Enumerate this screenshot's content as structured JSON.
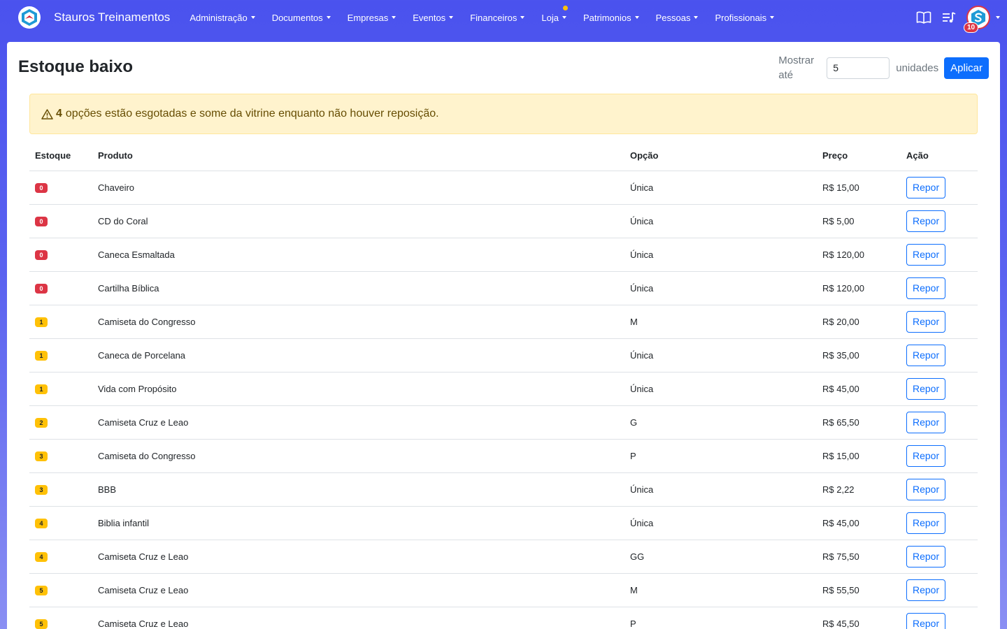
{
  "app": {
    "brand": "Stauros Treinamentos"
  },
  "nav": {
    "items": [
      {
        "label": "Administração",
        "name": "nav-administracao"
      },
      {
        "label": "Documentos",
        "name": "nav-documentos"
      },
      {
        "label": "Empresas",
        "name": "nav-empresas"
      },
      {
        "label": "Eventos",
        "name": "nav-eventos"
      },
      {
        "label": "Financeiros",
        "name": "nav-financeiros"
      },
      {
        "label": "Loja",
        "name": "nav-loja",
        "dot": true
      },
      {
        "label": "Patrimonios",
        "name": "nav-patrimonios"
      },
      {
        "label": "Pessoas",
        "name": "nav-pessoas"
      },
      {
        "label": "Profissionais",
        "name": "nav-profissionais"
      }
    ],
    "notification_count": "10",
    "icons": [
      "book-icon",
      "playlist-icon"
    ]
  },
  "page": {
    "title": "Estoque baixo"
  },
  "filter": {
    "label": "Mostrar até",
    "value": "5",
    "unit": "unidades",
    "apply_label": "Aplicar"
  },
  "alert": {
    "icon": "warning-icon",
    "count": "4",
    "message": "opções estão esgotadas e some da vitrine enquanto não houver reposição."
  },
  "table": {
    "headers": [
      "Estoque",
      "Produto",
      "Opção",
      "Preço",
      "Ação"
    ],
    "action_label": "Repor",
    "rows": [
      {
        "stock": "0",
        "status": "danger",
        "product": "Chaveiro",
        "option": "Única",
        "price": "R$ 15,00"
      },
      {
        "stock": "0",
        "status": "danger",
        "product": "CD do Coral",
        "option": "Única",
        "price": "R$ 5,00"
      },
      {
        "stock": "0",
        "status": "danger",
        "product": "Caneca Esmaltada",
        "option": "Única",
        "price": "R$ 120,00"
      },
      {
        "stock": "0",
        "status": "danger",
        "product": "Cartilha Bíblica",
        "option": "Única",
        "price": "R$ 120,00"
      },
      {
        "stock": "1",
        "status": "warning",
        "product": "Camiseta do Congresso",
        "option": "M",
        "price": "R$ 20,00"
      },
      {
        "stock": "1",
        "status": "warning",
        "product": "Caneca de Porcelana",
        "option": "Única",
        "price": "R$ 35,00"
      },
      {
        "stock": "1",
        "status": "warning",
        "product": "Vida com Propósito",
        "option": "Única",
        "price": "R$ 45,00"
      },
      {
        "stock": "2",
        "status": "warning",
        "product": "Camiseta Cruz e Leao",
        "option": "G",
        "price": "R$ 65,50"
      },
      {
        "stock": "3",
        "status": "warning",
        "product": "Camiseta do Congresso",
        "option": "P",
        "price": "R$ 15,00"
      },
      {
        "stock": "3",
        "status": "warning",
        "product": "BBB",
        "option": "Única",
        "price": "R$ 2,22"
      },
      {
        "stock": "4",
        "status": "warning",
        "product": "Biblia infantil",
        "option": "Única",
        "price": "R$ 45,00"
      },
      {
        "stock": "4",
        "status": "warning",
        "product": "Camiseta Cruz e Leao",
        "option": "GG",
        "price": "R$ 75,50"
      },
      {
        "stock": "5",
        "status": "warning",
        "product": "Camiseta Cruz e Leao",
        "option": "M",
        "price": "R$ 55,50"
      },
      {
        "stock": "5",
        "status": "warning",
        "product": "Camiseta Cruz e Leao",
        "option": "P",
        "price": "R$ 45,50"
      }
    ]
  },
  "colors": {
    "primary": "#0d6efd",
    "danger": "#dc3545",
    "warning": "#ffc107",
    "nav_bg": "#4a52ee",
    "alert_bg": "#fff3cd"
  }
}
